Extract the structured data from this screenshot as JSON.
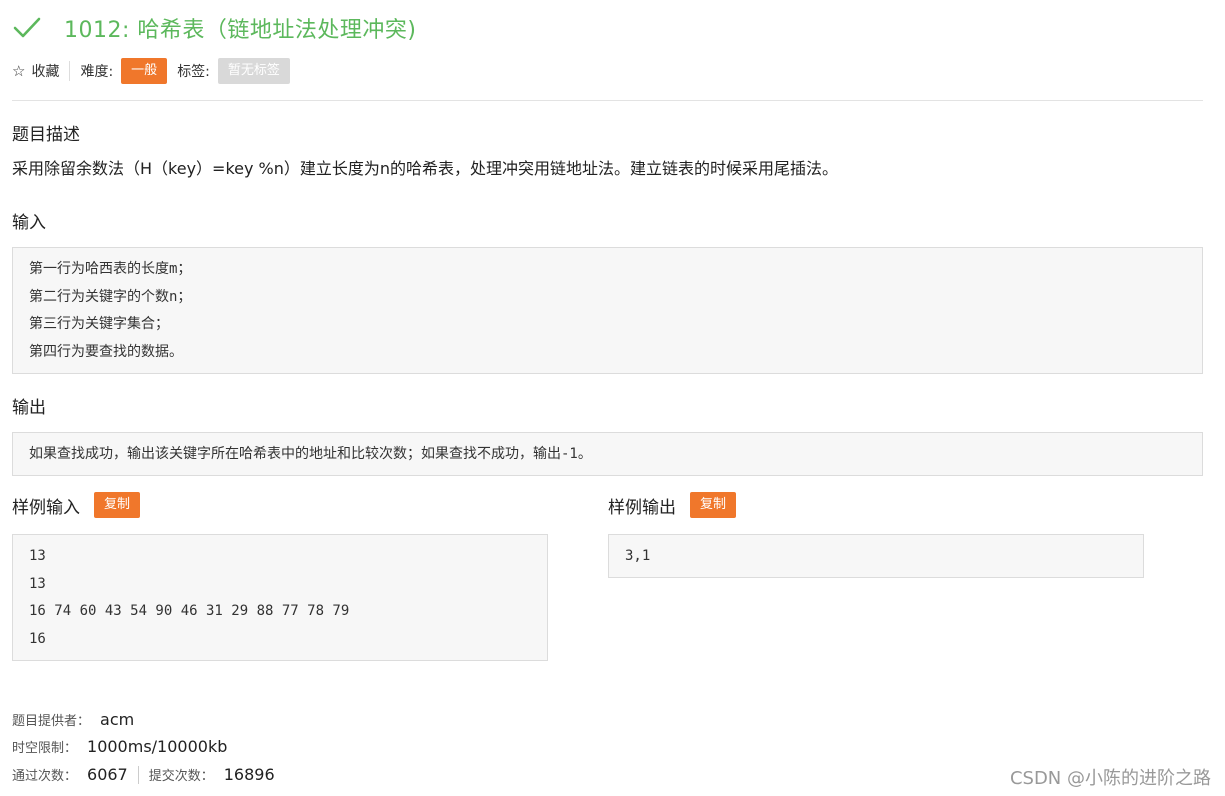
{
  "title": "1012: 哈希表（链地址法处理冲突)",
  "colors": {
    "accent_green": "#5cb85c",
    "accent_orange": "#f0772b",
    "tag_gray": "#d9d9d9"
  },
  "meta": {
    "favorite_label": "收藏",
    "difficulty_label": "难度:",
    "difficulty_value": "一般",
    "tags_label": "标签:",
    "tags_value": "暂无标签"
  },
  "description": {
    "heading": "题目描述",
    "text": "采用除留余数法（H（key）=key %n）建立长度为n的哈希表，处理冲突用链地址法。建立链表的时候采用尾插法。"
  },
  "input": {
    "heading": "输入",
    "lines": [
      "第一行为哈西表的长度m；",
      "第二行为关键字的个数n；",
      "第三行为关键字集合；",
      "第四行为要查找的数据。"
    ]
  },
  "output": {
    "heading": "输出",
    "lines": [
      "如果查找成功，输出该关键字所在哈希表中的地址和比较次数；如果查找不成功，输出-1。"
    ]
  },
  "sample_input": {
    "heading": "样例输入",
    "copy_label": "复制",
    "lines": [
      "13",
      "13",
      "16 74 60 43 54 90 46 31 29 88 77 78 79",
      "16"
    ]
  },
  "sample_output": {
    "heading": "样例输出",
    "copy_label": "复制",
    "lines": [
      "3,1"
    ]
  },
  "footer": {
    "provider_label": "题目提供者：",
    "provider_value": "acm",
    "limit_label": "时空限制：",
    "limit_value": "1000ms/10000kb",
    "passed_label": "通过次数：",
    "passed_value": "6067",
    "submitted_label": "提交次数：",
    "submitted_value": "16896"
  },
  "watermark": "CSDN @小陈的进阶之路",
  "icons": {
    "title_status": "check-icon",
    "favorite": "star-icon"
  }
}
